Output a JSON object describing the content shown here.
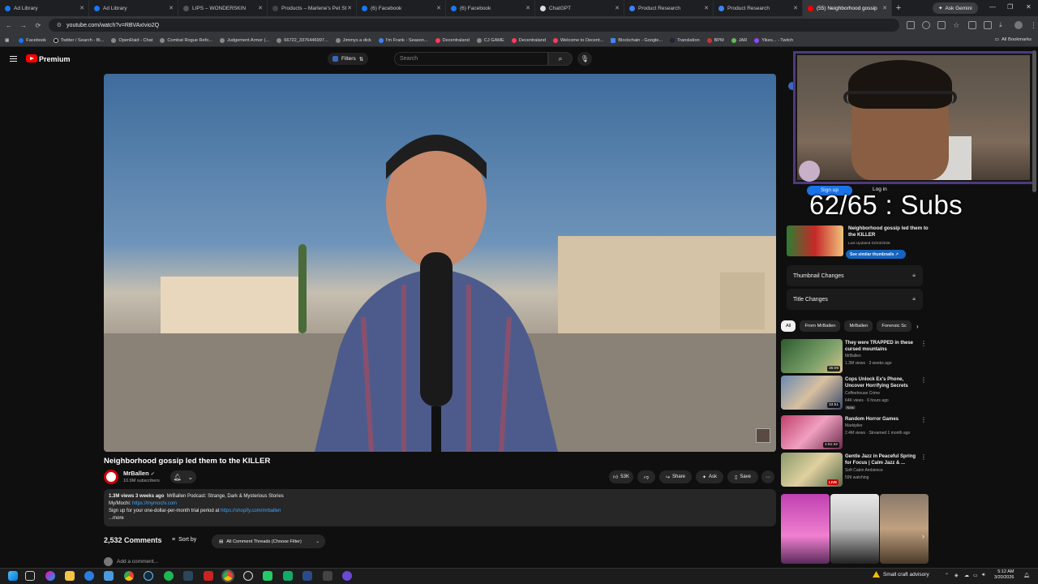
{
  "browser": {
    "tabs": [
      {
        "label": "Ad Library",
        "color": "#1877f2"
      },
      {
        "label": "Ad Library",
        "color": "#1877f2"
      },
      {
        "label": "LIPS – WONDERSKIN",
        "color": "#555555"
      },
      {
        "label": "Products – Marlene's Pet St",
        "color": "#444444"
      },
      {
        "label": "(6) Facebook",
        "color": "#1877f2"
      },
      {
        "label": "(6) Facebook",
        "color": "#1877f2"
      },
      {
        "label": "ChatGPT",
        "color": "#dddddd"
      },
      {
        "label": "Product Research",
        "color": "#3b82f6"
      },
      {
        "label": "Product Research",
        "color": "#3b82f6"
      },
      {
        "label": "(55) Neighborhood gossip",
        "color": "#ff0000"
      }
    ],
    "new_tab": "+",
    "gemini": "Ask Gemini",
    "url": "youtube.com/watch?v=RBVAxIvio2Q",
    "bookmarks": [
      "Facebook",
      "Twitter / Search - Bi...",
      "OpenRaid - Chat",
      "Combat Rogue Refo...",
      "Judgement Armor (...",
      "66722_3376446997...",
      "Jimmys a dick",
      "I'm Frank - Season...",
      "Decentraland",
      "CJ GAME",
      "Decentraland",
      "Welcome to Decent...",
      "Blockchain - Google...",
      "Translation",
      "BPM",
      "JAR",
      "Yikes... - Twitch"
    ],
    "all_bookmarks": "All Bookmarks"
  },
  "youtube": {
    "logo": "Premium",
    "filters": "Filters",
    "search_placeholder": "Search",
    "video_title": "Neighborhood gossip led them to the KILLER",
    "channel": {
      "name": "MrBallen",
      "subs": "10.9M subscribers"
    },
    "actions": {
      "likes": "53K",
      "share": "Share",
      "ask": "Ask",
      "save": "Save"
    },
    "description": {
      "meta": "1.3M views  3 weeks ago",
      "tagline": "MrBallen Podcast: Strange, Dark & Mysterious Stories",
      "line2_prefix": "My/Mochi: ",
      "line2_link": "https://mymochi.com",
      "line3_prefix": "Sign up for your one-dollar-per-month trial period at ",
      "line3_link": "https://shopify.com/mrballen",
      "more": "...more"
    },
    "comments": {
      "count": "2,532 Comments",
      "sort": "Sort by",
      "filter": "All Comment Threads (Choose Filter)",
      "add": "Add a comment..."
    }
  },
  "sidebar": {
    "thumb_card": {
      "title": "Neighborhood gossip led them to the KILLER",
      "updated": "Last Updated 03/23/2026",
      "button": "See similar thumbnails ↗"
    },
    "thumbnail_changes": "Thumbnail Changes",
    "title_changes": "Title Changes",
    "chips": [
      "All",
      "From MrBallen",
      "MrBallen",
      "Forensic Sc"
    ],
    "recs": [
      {
        "title": "They were TRAPPED in these cursed mountains",
        "channel": "MrBallen",
        "meta": "1.3M views · 3 weeks ago",
        "duration": "35:09",
        "badge": "",
        "thumb": "#3a6a3a"
      },
      {
        "title": "Cops Unlock Ex's Phone, Uncover Horrifying Secrets",
        "channel": "Coffeehouse Crime",
        "meta": "64K views · 6 hours ago",
        "duration": "33:51",
        "badge": "New",
        "thumb": "#6a8ab0"
      },
      {
        "title": "Random Horror Games",
        "channel": "Markiplier",
        "meta": "2.4M views · Streamed 1 month ago",
        "duration": "1:51:42",
        "badge": "",
        "thumb": "#c0406a"
      },
      {
        "title": "Gentle Jazz in Peaceful Spring for Focus | Calm Jazz & ...",
        "channel": "Soft Cabin Ambience",
        "meta": "599 watching",
        "duration": "",
        "badge": "LIVE",
        "thumb": "#8a9a6a"
      }
    ]
  },
  "overlay": {
    "sign_up": "Sign up",
    "log_in": "Log in",
    "subs_text": "62/65 : Subs"
  },
  "taskbar": {
    "weather": "Small craft advisory",
    "time": "5:12 AM",
    "date": "3/20/2026"
  }
}
